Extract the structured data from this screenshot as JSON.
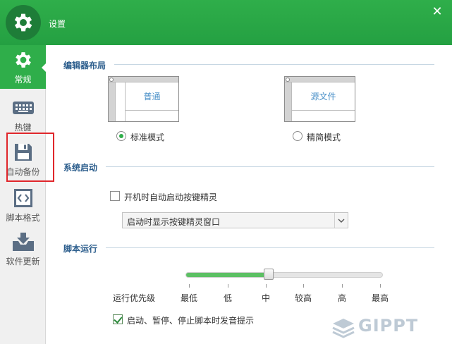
{
  "window": {
    "title": "设置",
    "close_icon": "close-icon"
  },
  "sidebar": {
    "items": [
      {
        "label": "常规",
        "icon": "gear-icon",
        "active": true
      },
      {
        "label": "热键",
        "icon": "keyboard-icon",
        "active": false
      },
      {
        "label": "自动备份",
        "icon": "floppy-disk-icon",
        "active": false
      },
      {
        "label": "脚本格式",
        "icon": "code-brackets-icon",
        "active": false
      },
      {
        "label": "软件更新",
        "icon": "download-tray-icon",
        "active": false
      }
    ]
  },
  "editor_layout": {
    "title": "编辑器布局",
    "standard": {
      "thumb_label": "普通",
      "radio_label": "标准模式",
      "selected": true
    },
    "compact": {
      "thumb_label": "源文件",
      "radio_label": "精简模式",
      "selected": false
    }
  },
  "startup": {
    "title": "系统启动",
    "auto_start_label": "开机时自动启动按键精灵",
    "auto_start_checked": false,
    "window_select_value": "启动时显示按键精灵窗口"
  },
  "script_run": {
    "title": "脚本运行",
    "priority_label": "运行优先级",
    "priority_levels": [
      "最低",
      "低",
      "中",
      "较高",
      "高",
      "最高"
    ],
    "priority_value": "中",
    "priority_fraction": 0.42,
    "sound_label": "启动、暂停、停止脚本时发音提示",
    "sound_checked": true
  },
  "colors": {
    "accent_green": "#2fae4a",
    "section_title": "#2b5d8c",
    "highlight_red": "#e0262b"
  },
  "watermark": {
    "text": "GIPPT"
  }
}
